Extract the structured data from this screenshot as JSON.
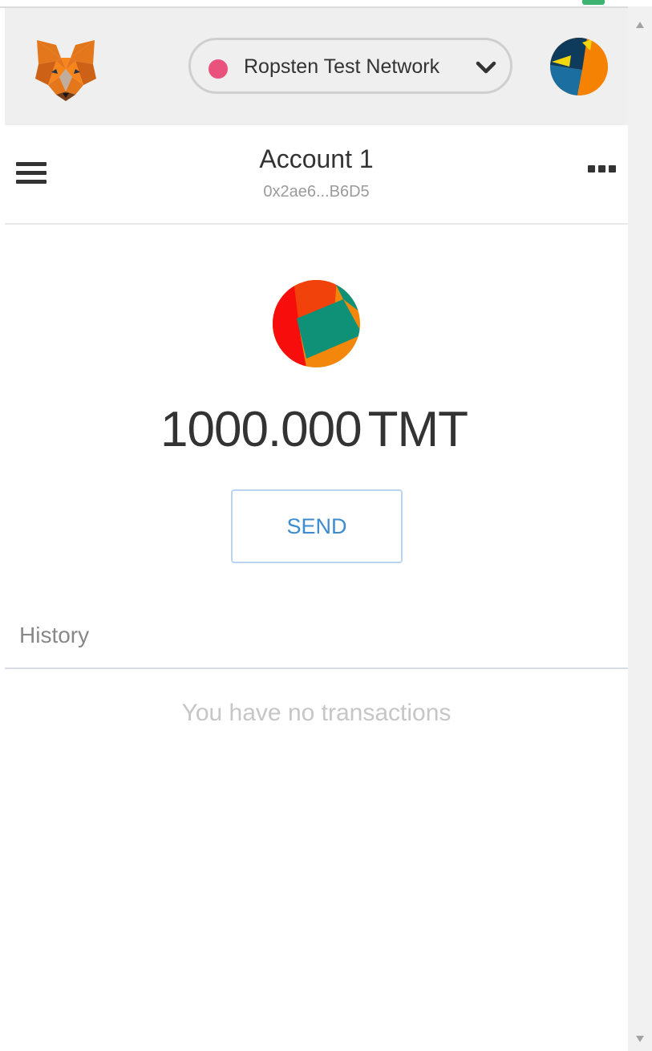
{
  "network": {
    "name": "Ropsten Test Network",
    "dot_color": "#e8527c"
  },
  "account": {
    "name": "Account 1",
    "address": "0x2ae6...B6D5"
  },
  "balance": {
    "amount": "1000.000",
    "symbol": "TMT"
  },
  "actions": {
    "send_label": "SEND"
  },
  "history": {
    "label": "History",
    "empty_message": "You have no transactions"
  },
  "icons": {
    "logo": "metamask-fox-icon",
    "network_status": "network-status-dot-icon",
    "dropdown": "chevron-down-icon",
    "menu": "hamburger-menu-icon",
    "more": "more-options-icon",
    "account_avatar": "account-identicon",
    "token_avatar": "token-identicon"
  },
  "colors": {
    "header_bg": "#efefef",
    "accent_blue": "#3d8bd0",
    "send_border": "#b8d4ee"
  }
}
